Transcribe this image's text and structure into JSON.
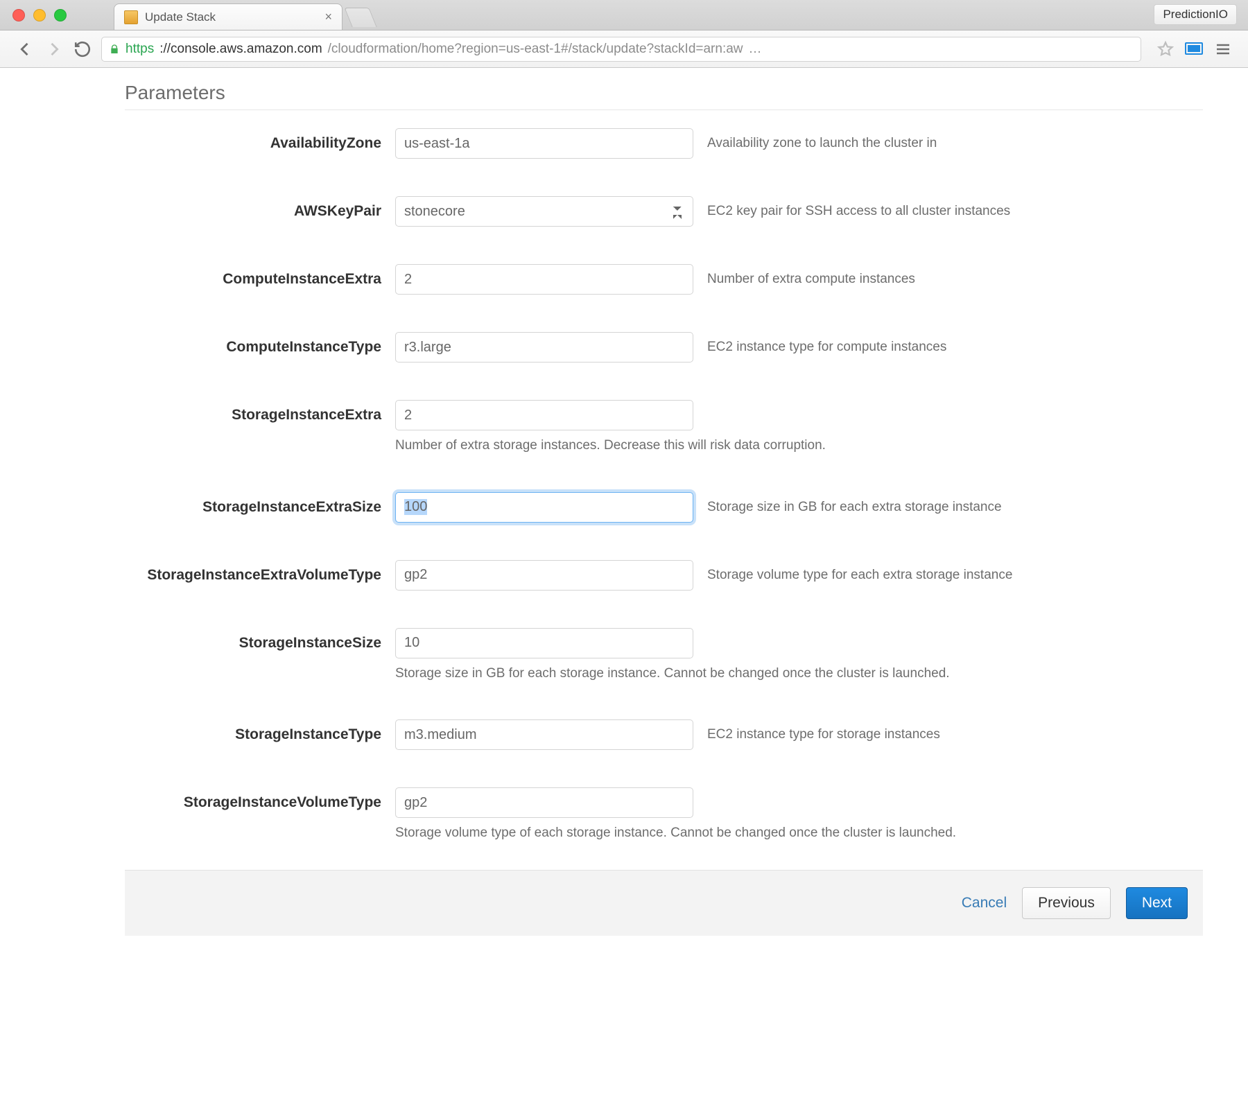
{
  "browser": {
    "tab_title": "Update Stack",
    "profile_badge": "PredictionIO",
    "url": {
      "scheme": "https",
      "host": "://console.aws.amazon.com",
      "path": "/cloudformation/home?region=us-east-1#/stack/update?stackId=arn:aw",
      "truncated": "…"
    }
  },
  "page": {
    "section_title": "Parameters",
    "params": {
      "availability_zone": {
        "label": "AvailabilityZone",
        "value": "us-east-1a",
        "desc": "Availability zone to launch the cluster in"
      },
      "aws_key_pair": {
        "label": "AWSKeyPair",
        "value": "stonecore",
        "desc": "EC2 key pair for SSH access to all cluster instances"
      },
      "compute_extra": {
        "label": "ComputeInstanceExtra",
        "value": "2",
        "desc": "Number of extra compute instances"
      },
      "compute_type": {
        "label": "ComputeInstanceType",
        "value": "r3.large",
        "desc": "EC2 instance type for compute instances"
      },
      "storage_extra": {
        "label": "StorageInstanceExtra",
        "value": "2",
        "desc_below": "Number of extra storage instances. Decrease this will risk data corruption."
      },
      "storage_extra_size": {
        "label": "StorageInstanceExtraSize",
        "value": "100",
        "desc": "Storage size in GB for each extra storage instance"
      },
      "storage_extra_vt": {
        "label": "StorageInstanceExtraVolumeType",
        "value": "gp2",
        "desc": "Storage volume type for each extra storage instance"
      },
      "storage_size": {
        "label": "StorageInstanceSize",
        "value": "10",
        "desc_below": "Storage size in GB for each storage instance. Cannot be changed once the cluster is launched."
      },
      "storage_type": {
        "label": "StorageInstanceType",
        "value": "m3.medium",
        "desc": "EC2 instance type for storage instances"
      },
      "storage_vt": {
        "label": "StorageInstanceVolumeType",
        "value": "gp2",
        "desc_below": "Storage volume type of each storage instance. Cannot be changed once the cluster is launched."
      }
    },
    "footer": {
      "cancel": "Cancel",
      "previous": "Previous",
      "next": "Next"
    }
  }
}
